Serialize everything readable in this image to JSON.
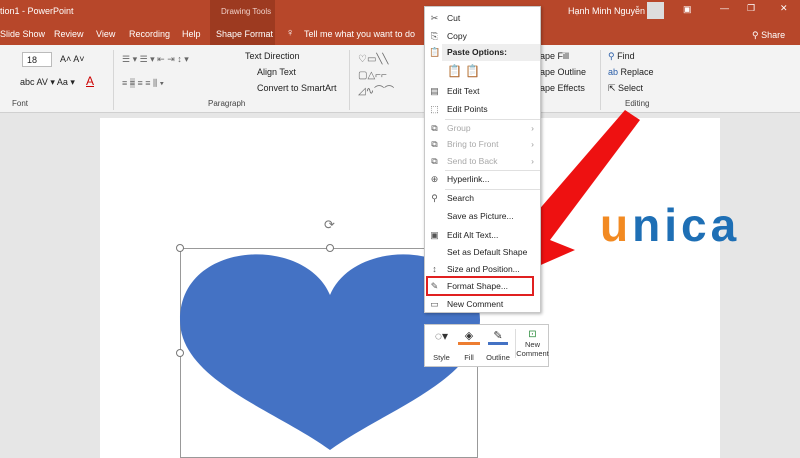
{
  "title_bar": {
    "title": "tion1 - PowerPoint",
    "context": "Drawing Tools",
    "user": "Hạnh Minh Nguyễn",
    "share": "Share"
  },
  "tabs": [
    "Slide Show",
    "Review",
    "View",
    "Recording",
    "Help",
    "Shape Format"
  ],
  "tell_me": "Tell me what you want to do",
  "ribbon": {
    "font_size": "18",
    "font_group": "Font",
    "paragraph_group": "Paragraph",
    "editing_group": "Editing",
    "text_direction": "Text Direction",
    "align_text": "Align Text",
    "convert_smartart": "Convert to SmartArt",
    "shape_fill": "ape Fill",
    "shape_outline": "ape Outline",
    "shape_effects": "ape Effects",
    "find": "Find",
    "replace": "Replace",
    "select": "Select"
  },
  "context_menu": {
    "items": [
      {
        "label": "Cut",
        "icon": "scissors-icon",
        "disabled": false
      },
      {
        "label": "Copy",
        "icon": "copy-icon",
        "disabled": false
      },
      {
        "label": "Paste Options:",
        "icon": "paste-icon",
        "disabled": false
      },
      {
        "label": "Edit Text",
        "icon": "edit-text-icon",
        "disabled": false
      },
      {
        "label": "Edit Points",
        "icon": "edit-points-icon",
        "disabled": false
      },
      {
        "label": "Group",
        "icon": "group-icon",
        "disabled": true
      },
      {
        "label": "Bring to Front",
        "icon": "bring-front-icon",
        "disabled": true
      },
      {
        "label": "Send to Back",
        "icon": "send-back-icon",
        "disabled": true
      },
      {
        "label": "Hyperlink...",
        "icon": "hyperlink-icon",
        "disabled": false
      },
      {
        "label": "Search",
        "icon": "search-icon",
        "disabled": false
      },
      {
        "label": "Save as Picture...",
        "icon": "",
        "disabled": false
      },
      {
        "label": "Edit Alt Text...",
        "icon": "alt-text-icon",
        "disabled": false
      },
      {
        "label": "Set as Default Shape",
        "icon": "",
        "disabled": false
      },
      {
        "label": "Size and Position...",
        "icon": "size-icon",
        "disabled": false
      },
      {
        "label": "Format Shape...",
        "icon": "format-shape-icon",
        "disabled": false
      },
      {
        "label": "New Comment",
        "icon": "comment-icon",
        "disabled": false
      }
    ]
  },
  "mini_toolbar": {
    "style": "Style",
    "fill": "Fill",
    "outline": "Outline",
    "new_comment_1": "New",
    "new_comment_2": "Comment"
  },
  "logo": "unica",
  "colors": {
    "accent": "#b7472a",
    "shape": "#4472c4",
    "arrow": "#ee1111",
    "logo_orange": "#f28a22",
    "logo_blue": "#1e6fb5"
  }
}
